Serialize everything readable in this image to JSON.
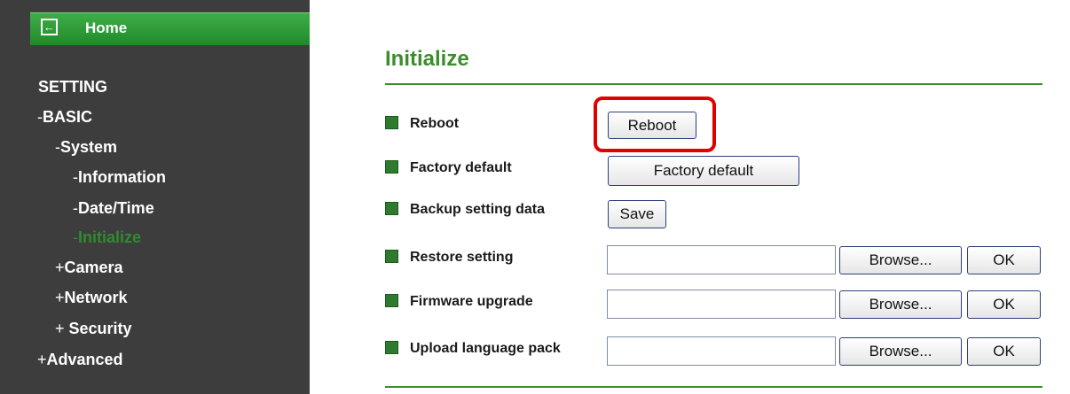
{
  "sidebar": {
    "home_label": "Home",
    "home_icon": "arrow-left-icon",
    "setting_label": "SETTING",
    "items": [
      {
        "mark": "-",
        "label": "BASIC"
      },
      {
        "mark": "-",
        "label": "System"
      },
      {
        "mark": "-",
        "label": "Information"
      },
      {
        "mark": "-",
        "label": "Date/Time"
      },
      {
        "mark": "-",
        "label": "Initialize"
      },
      {
        "mark": "+",
        "label": "Camera"
      },
      {
        "mark": "+",
        "label": "Network"
      },
      {
        "mark": "+",
        "label": " Security"
      },
      {
        "mark": "+",
        "label": "Advanced"
      }
    ],
    "active_item": "Initialize"
  },
  "main": {
    "title": "Initialize",
    "rows": {
      "reboot": {
        "label": "Reboot",
        "button": "Reboot"
      },
      "factory": {
        "label": "Factory default",
        "button": "Factory default"
      },
      "backup": {
        "label": "Backup setting data",
        "button": "Save"
      },
      "restore": {
        "label": "Restore setting",
        "browse": "Browse...",
        "ok": "OK"
      },
      "firmware": {
        "label": "Firmware upgrade",
        "browse": "Browse...",
        "ok": "OK"
      },
      "language": {
        "label": "Upload language pack",
        "browse": "Browse...",
        "ok": "OK"
      }
    }
  },
  "colors": {
    "sidebar_bg": "#3d3d3d",
    "accent_green": "#3b8e2a",
    "highlight_red": "#e10000"
  }
}
